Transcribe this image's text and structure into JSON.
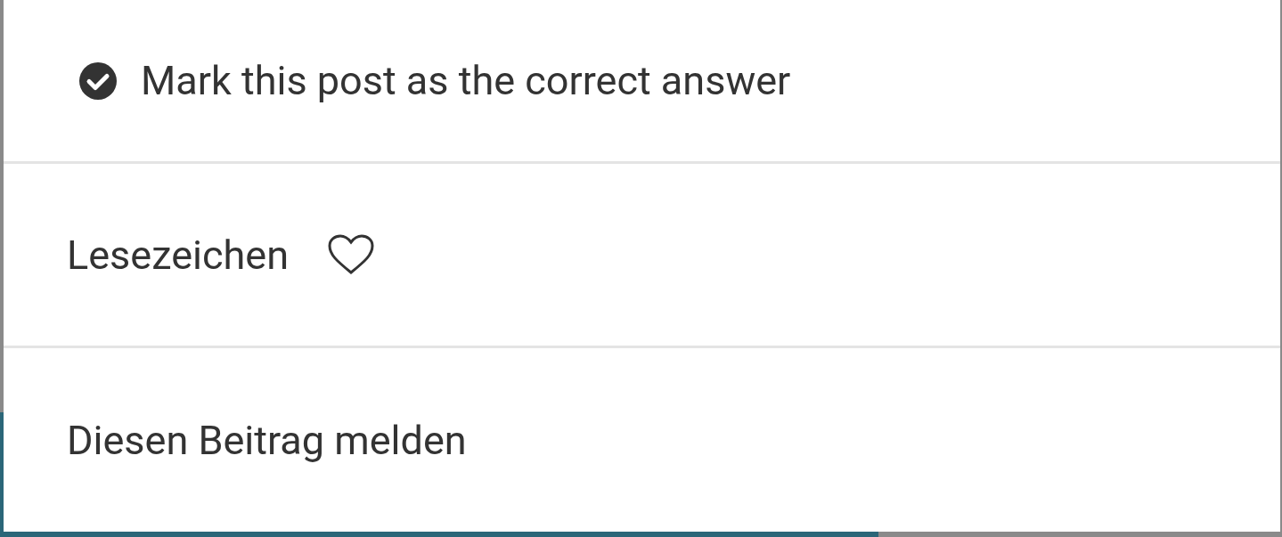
{
  "menu": {
    "items": [
      {
        "kind": "check",
        "label": "Mark this post as the correct answer"
      },
      {
        "kind": "bookmark",
        "label": "Lesezeichen"
      },
      {
        "kind": "plain",
        "label": "Diesen Beitrag melden"
      }
    ]
  }
}
